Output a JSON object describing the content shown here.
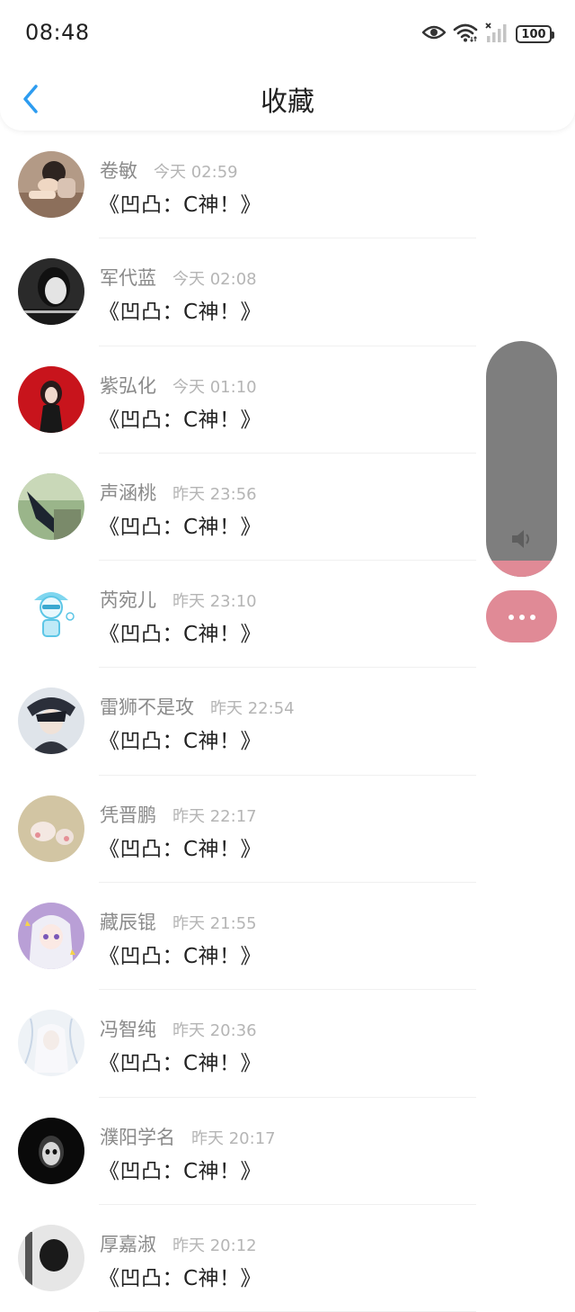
{
  "status_bar": {
    "time": "08:48",
    "battery": "100",
    "icons": [
      "eye-icon",
      "wifi-icon",
      "signal-icon",
      "battery-icon"
    ]
  },
  "header": {
    "back_icon": "chevron-left-icon",
    "title": "收藏"
  },
  "colors": {
    "accent": "#2d9cf0",
    "name_text": "#8a8a8a",
    "time_text": "#b5b5b5",
    "float_panel": "#7e7e7e",
    "float_accent": "#e08a96"
  },
  "floating_controls": {
    "volume_level": 0.07,
    "volume_icon": "speaker-icon",
    "more_icon": "more-dots-icon"
  },
  "items": [
    {
      "name": "卷敏",
      "time": "今天 02:59",
      "title": "《凹凸：C神！》"
    },
    {
      "name": "军代蓝",
      "time": "今天 02:08",
      "title": "《凹凸：C神！》"
    },
    {
      "name": "紫弘化",
      "time": "今天 01:10",
      "title": "《凹凸：C神！》"
    },
    {
      "name": "声涵桃",
      "time": "昨天 23:56",
      "title": "《凹凸：C神！》"
    },
    {
      "name": "芮宛儿",
      "time": "昨天 23:10",
      "title": "《凹凸：C神！》"
    },
    {
      "name": "雷狮不是攻",
      "time": "昨天 22:54",
      "title": "《凹凸：C神！》"
    },
    {
      "name": "凭晋鹏",
      "time": "昨天 22:17",
      "title": "《凹凸：C神！》"
    },
    {
      "name": "藏辰锟",
      "time": "昨天 21:55",
      "title": "《凹凸：C神！》"
    },
    {
      "name": "冯智纯",
      "time": "昨天 20:36",
      "title": "《凹凸：C神！》"
    },
    {
      "name": "濮阳学名",
      "time": "昨天 20:17",
      "title": "《凹凸：C神！》"
    },
    {
      "name": "厚嘉淑",
      "time": "昨天 20:12",
      "title": "《凹凸：C神！》"
    }
  ]
}
